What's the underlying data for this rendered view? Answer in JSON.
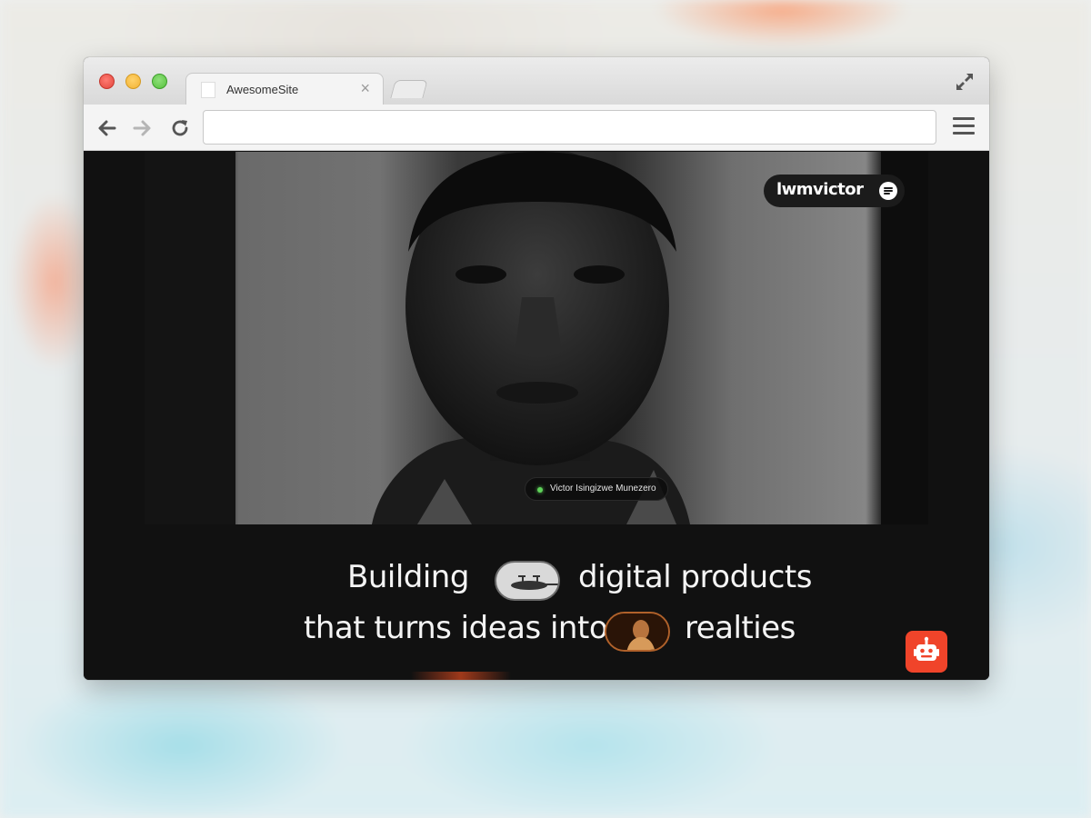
{
  "browser": {
    "tab_title": "AwesomeSite",
    "tab_close": "×",
    "address_value": ""
  },
  "site": {
    "brand": "lwmvictor",
    "name_tag": "Victor Isingizwe Munezero",
    "headline": {
      "line1_a": "Building",
      "line1_b": "digital products",
      "line2_a": "that turns ideas into",
      "line2_b": "realties"
    }
  },
  "colors": {
    "accent": "#f0442a",
    "status_dot": "#5fd35a",
    "page_bg": "#111111"
  },
  "icons": [
    "back-arrow-icon",
    "forward-arrow-icon",
    "reload-icon",
    "hamburger-menu-icon",
    "fullscreen-icon",
    "menu-icon",
    "robot-icon"
  ]
}
